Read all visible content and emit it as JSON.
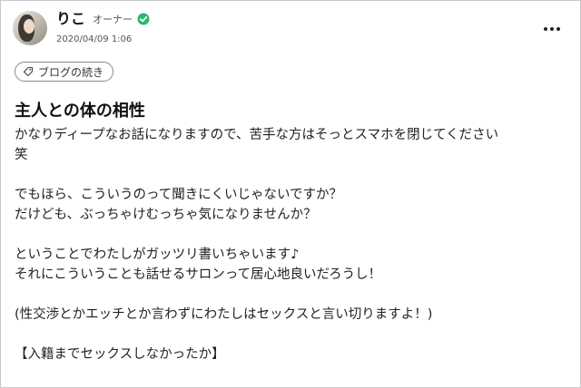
{
  "post": {
    "author": {
      "name": "りこ",
      "role": "オーナー",
      "verified_icon": "verified-check-icon"
    },
    "timestamp": "2020/04/09 1:06",
    "more_icon": "more-horizontal-icon",
    "tag": {
      "icon": "tag-icon",
      "label": "ブログの続き"
    },
    "title": "主人との体の相性",
    "lines": [
      "かなりディープなお話になりますので、苦手な方はそっとスマホを閉じてください",
      "笑",
      "",
      "でもほら、こういうのって聞きにくいじゃないですか？",
      "だけども、ぶっちゃけむっちゃ気になりませんか？",
      "",
      "ということでわたしがガッツリ書いちゃいます♪",
      "それにこういうことも話せるサロンって居心地良いだろうし！",
      "",
      "(性交渉とかエッチとか言わずにわたしはセックスと言い切りますよ！)",
      "",
      "【入籍までセックスしなかったか】"
    ]
  },
  "colors": {
    "verified": "#2bb673",
    "text": "#222222",
    "border": "#8a8a8a"
  }
}
